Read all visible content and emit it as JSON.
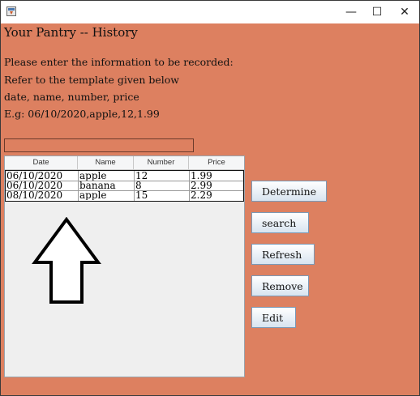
{
  "window": {
    "controls": {
      "minimize": "—",
      "maximize": "☐",
      "close": "✕"
    }
  },
  "heading": "Your Pantry -- History",
  "instructions": [
    "Please enter the information to be recorded:",
    "Refer to the template given below",
    "date, name, number, price",
    "E.g: 06/10/2020,apple,12,1.99"
  ],
  "input": {
    "value": ""
  },
  "table": {
    "columns": [
      "Date",
      "Name",
      "Number",
      "Price"
    ],
    "rows": [
      [
        "06/10/2020",
        "apple",
        "12",
        "1.99"
      ],
      [
        "06/10/2020",
        "banana",
        "8",
        "2.99"
      ],
      [
        "08/10/2020",
        "apple",
        "15",
        "2.29"
      ]
    ]
  },
  "buttons": {
    "determine": "Determine",
    "search": "search",
    "refresh": "Refresh",
    "remove": "Remove",
    "edit": "Edit"
  },
  "colors": {
    "background": "#dd8060",
    "button_border": "#7a9ab8"
  },
  "icons": {
    "app": "java-app-icon",
    "drawing": "up-arrow-icon"
  }
}
